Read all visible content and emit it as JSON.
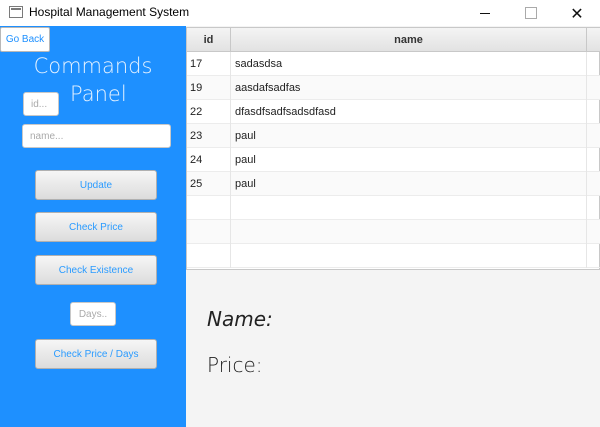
{
  "window": {
    "title": "Hospital Management System",
    "minimize_icon": "minimize-icon",
    "maximize_icon": "maximize-icon",
    "close_icon": "close-icon",
    "close_glyph": "✕"
  },
  "sidebar": {
    "background": "#1e90ff",
    "go_back_label": "Go Back",
    "title_line1": "Commands",
    "title_line2": "Panel",
    "id_placeholder": "id...",
    "name_placeholder": "name...",
    "days_placeholder": "Days..",
    "buttons": {
      "update": "Update",
      "check_price": "Check Price",
      "check_existence": "Check Existence",
      "check_price_days": "Check Price / Days"
    }
  },
  "table": {
    "columns": [
      "id",
      "name"
    ],
    "rows": [
      {
        "id": "17",
        "name": "sadasdsa"
      },
      {
        "id": "19",
        "name": "aasdafsadfas"
      },
      {
        "id": "22",
        "name": "dfasdfsadfsadsdfasd"
      },
      {
        "id": "23",
        "name": "paul"
      },
      {
        "id": "24",
        "name": "paul"
      },
      {
        "id": "25",
        "name": "paul"
      },
      {
        "id": "",
        "name": ""
      },
      {
        "id": "",
        "name": ""
      },
      {
        "id": "",
        "name": ""
      }
    ]
  },
  "info": {
    "name_label": "Name:",
    "price_label": "Price:"
  }
}
